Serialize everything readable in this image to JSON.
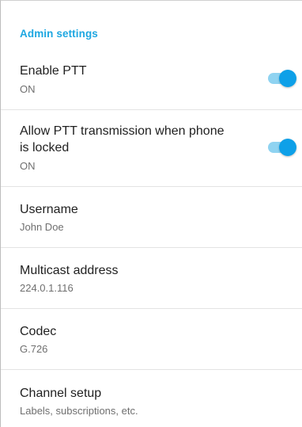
{
  "section": {
    "header": "Admin settings"
  },
  "items": [
    {
      "title": "Enable PTT",
      "subtitle": "ON",
      "toggle_on": true
    },
    {
      "title_line1": "Allow PTT transmission when phone",
      "title_line2": "is locked",
      "subtitle": "ON",
      "toggle_on": true
    },
    {
      "title": "Username",
      "subtitle": "John Doe"
    },
    {
      "title": "Multicast address",
      "subtitle": "224.0.1.116"
    },
    {
      "title": "Codec",
      "subtitle": "G.726"
    },
    {
      "title": "Channel setup",
      "subtitle": "Labels, subscriptions, etc."
    }
  ],
  "colors": {
    "accent": "#1ea7e1",
    "toggle_thumb": "#0ea0e8",
    "toggle_track": "#8fd3f1",
    "title_text": "#212121",
    "subtitle_text": "#6f6f6f",
    "divider": "#e3e3e3"
  }
}
